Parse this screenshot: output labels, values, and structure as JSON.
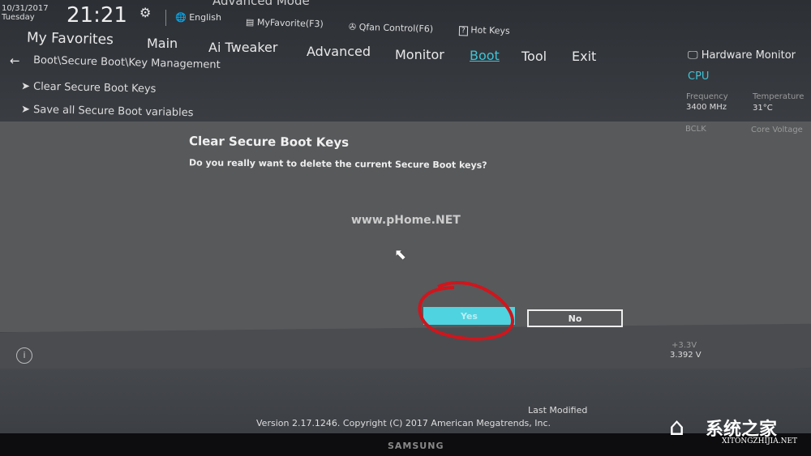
{
  "header": {
    "mode": "Advanced Mode",
    "date": "10/31/2017",
    "day": "Tuesday",
    "time": "21:21",
    "language": "English",
    "myfavorite": "MyFavorite(F3)",
    "qfan": "Qfan Control(F6)",
    "hotkeys": "Hot Keys"
  },
  "tabs": [
    {
      "label": "My Favorites"
    },
    {
      "label": "Main"
    },
    {
      "label": "Ai Tweaker"
    },
    {
      "label": "Advanced"
    },
    {
      "label": "Monitor"
    },
    {
      "label": "Boot",
      "active": true
    },
    {
      "label": "Tool"
    },
    {
      "label": "Exit"
    }
  ],
  "breadcrumb": "Boot\\Secure Boot\\Key Management",
  "menu": [
    {
      "label": "Clear Secure Boot Keys"
    },
    {
      "label": "Save all Secure Boot variables"
    }
  ],
  "hw": {
    "title": "Hardware Monitor",
    "section": "CPU",
    "freq_label": "Frequency",
    "freq": "3400 MHz",
    "temp_label": "Temperature",
    "temp": "31°C",
    "bclk_label": "BCLK",
    "vcore_label": "Core Voltage",
    "v33_label": "+3.3V",
    "v33": "3.392 V"
  },
  "dialog": {
    "title": "Clear Secure Boot Keys",
    "message": "Do you really want to delete the current Secure Boot keys?",
    "yes": "Yes",
    "no": "No"
  },
  "footer": {
    "last_modified": "Last Modified",
    "version": "Version 2.17.1246. Copyright (C) 2017 American Megatrends, Inc."
  },
  "watermarks": {
    "phome": "www.pHome.NET",
    "site_cn": "系统之家",
    "site": "XITONGZHIJIA.NET"
  },
  "bezel": "SAMSUNG",
  "colors": {
    "accent": "#3fc3d6",
    "annotation": "#d0151c"
  }
}
